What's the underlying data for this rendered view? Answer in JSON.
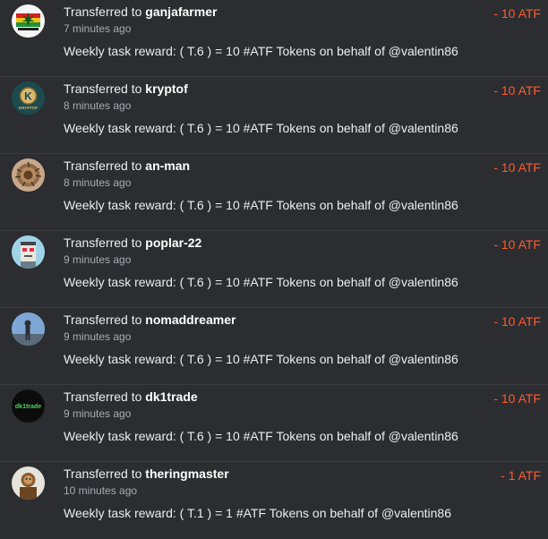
{
  "transfers": [
    {
      "prefix": "Transferred to",
      "user": "ganjafarmer",
      "time": "7 minutes ago",
      "memo": "Weekly task reward: ( T.6 ) = 10 #ATF Tokens on behalf of @valentin86",
      "amount": "- 10 ATF",
      "avatar": "ganjafarmer-avatar"
    },
    {
      "prefix": "Transferred to",
      "user": "kryptof",
      "time": "8 minutes ago",
      "memo": "Weekly task reward: ( T.6 ) = 10 #ATF Tokens on behalf of @valentin86",
      "amount": "- 10 ATF",
      "avatar": "kryptof-avatar"
    },
    {
      "prefix": "Transferred to",
      "user": "an-man",
      "time": "8 minutes ago",
      "memo": "Weekly task reward: ( T.6 ) = 10 #ATF Tokens on behalf of @valentin86",
      "amount": "- 10 ATF",
      "avatar": "an-man-avatar"
    },
    {
      "prefix": "Transferred to",
      "user": "poplar-22",
      "time": "9 minutes ago",
      "memo": "Weekly task reward: ( T.6 ) = 10 #ATF Tokens on behalf of @valentin86",
      "amount": "- 10 ATF",
      "avatar": "poplar-22-avatar"
    },
    {
      "prefix": "Transferred to",
      "user": "nomaddreamer",
      "time": "9 minutes ago",
      "memo": "Weekly task reward: ( T.6 ) = 10 #ATF Tokens on behalf of @valentin86",
      "amount": "- 10 ATF",
      "avatar": "nomaddreamer-avatar"
    },
    {
      "prefix": "Transferred to",
      "user": "dk1trade",
      "time": "9 minutes ago",
      "memo": "Weekly task reward: ( T.6 ) = 10 #ATF Tokens on behalf of @valentin86",
      "amount": "- 10 ATF",
      "avatar": "dk1trade-avatar"
    },
    {
      "prefix": "Transferred to",
      "user": "theringmaster",
      "time": "10 minutes ago",
      "memo": "Weekly task reward: ( T.1 ) = 1 #ATF Tokens on behalf of @valentin86",
      "amount": "- 1 ATF",
      "avatar": "theringmaster-avatar"
    }
  ],
  "avatar_text": {
    "kryptof": "K",
    "kryptof_sub": "KRYPTOF",
    "dk1trade": "dk1trade"
  },
  "colors": {
    "background": "#2b2d31",
    "amount": "#ff5b2e",
    "divider": "#3a3c41"
  }
}
